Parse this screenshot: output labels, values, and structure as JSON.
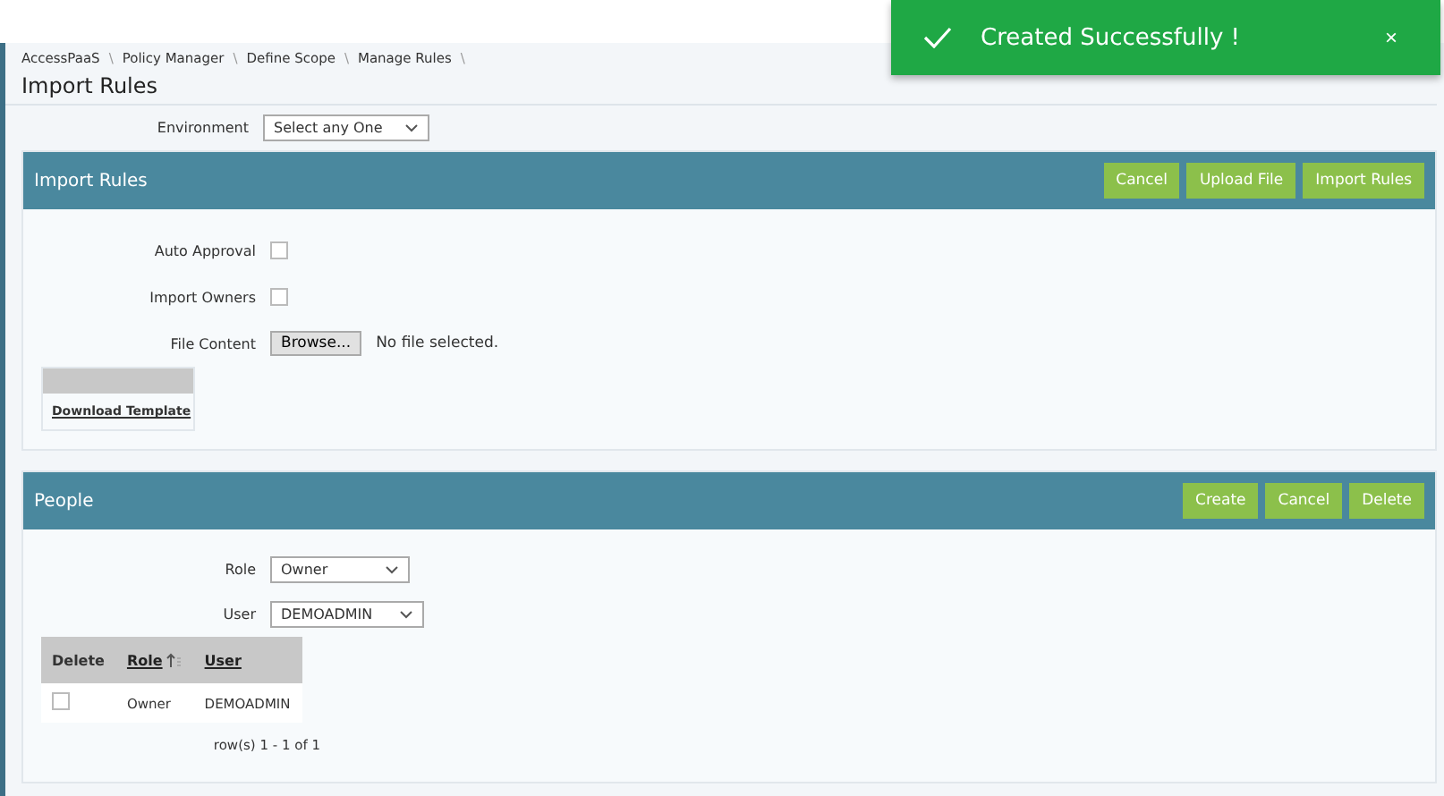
{
  "toast": {
    "message": "Created Successfully !",
    "close": "×"
  },
  "breadcrumb": [
    "AccessPaaS",
    "Policy Manager",
    "Define Scope",
    "Manage Rules"
  ],
  "breadcrumb_separator": "\\",
  "page_title": "Import Rules",
  "environment": {
    "label": "Environment",
    "value": "Select any One"
  },
  "import_panel": {
    "title": "Import Rules",
    "buttons": [
      "Cancel",
      "Upload File",
      "Import Rules"
    ],
    "checkboxes": [
      {
        "label": "Auto Approval",
        "checked": false
      },
      {
        "label": "Import Owners",
        "checked": false
      }
    ],
    "file": {
      "label": "File Content",
      "button": "Browse...",
      "status": "No file selected."
    },
    "download": "Download Template"
  },
  "people_panel": {
    "title": "People",
    "buttons": [
      "Create",
      "Cancel",
      "Delete"
    ],
    "selects": [
      {
        "label": "Role",
        "value": "Owner"
      },
      {
        "label": "User",
        "value": "DEMOADMIN"
      }
    ],
    "table": {
      "columns": [
        {
          "label": "Delete",
          "kind": "plain"
        },
        {
          "label": "Role",
          "kind": "sort"
        },
        {
          "label": "User",
          "kind": "link"
        }
      ],
      "rows": [
        {
          "checked": false,
          "role": "Owner",
          "user": "DEMOADMIN"
        }
      ],
      "pager": "row(s) 1 - 1 of 1"
    }
  }
}
